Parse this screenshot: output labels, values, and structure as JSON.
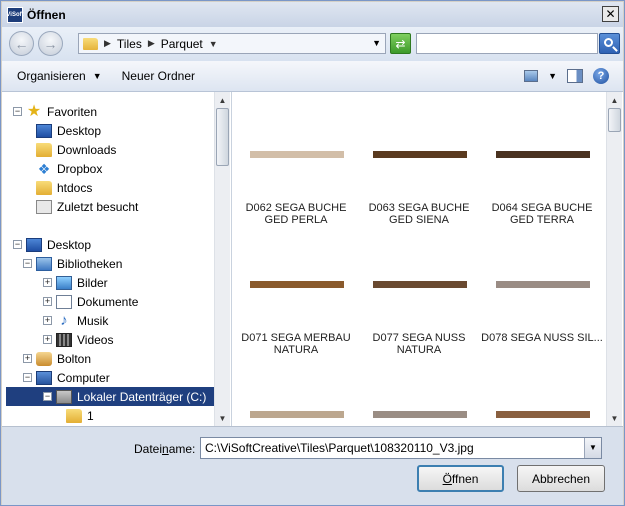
{
  "window": {
    "title": "Öffnen",
    "icon_text": "ViSoft"
  },
  "address": {
    "crumbs": [
      "Tiles",
      "Parquet"
    ],
    "search_placeholder": ""
  },
  "toolbar": {
    "organize_label": "Organisieren",
    "new_folder_label": "Neuer Ordner"
  },
  "nav_tree": [
    {
      "label": "Favoriten",
      "icon": "star-icon",
      "level": 0,
      "expander": "−"
    },
    {
      "label": "Desktop",
      "icon": "desktop-icon",
      "level": 1
    },
    {
      "label": "Downloads",
      "icon": "folder-icon",
      "level": 1
    },
    {
      "label": "Dropbox",
      "icon": "dropbox-icon",
      "level": 1
    },
    {
      "label": "htdocs",
      "icon": "folder-icon",
      "level": 1
    },
    {
      "label": "Zuletzt besucht",
      "icon": "recent-places-icon",
      "level": 1
    },
    {
      "label": "Desktop",
      "icon": "desktop-icon",
      "level": 0,
      "expander": "−"
    },
    {
      "label": "Bibliotheken",
      "icon": "libraries-icon",
      "level": 1,
      "expander": "−"
    },
    {
      "label": "Bilder",
      "icon": "pictures-icon",
      "level": 2,
      "expander": "+"
    },
    {
      "label": "Dokumente",
      "icon": "documents-icon",
      "level": 2,
      "expander": "+"
    },
    {
      "label": "Musik",
      "icon": "music-icon",
      "level": 2,
      "expander": "+"
    },
    {
      "label": "Videos",
      "icon": "videos-icon",
      "level": 2,
      "expander": "+"
    },
    {
      "label": "Bolton",
      "icon": "user-folder-icon",
      "level": 1,
      "expander": "+"
    },
    {
      "label": "Computer",
      "icon": "computer-icon",
      "level": 1,
      "expander": "−"
    },
    {
      "label": "Lokaler Datenträger (C:)",
      "icon": "drive-icon",
      "level": 2,
      "expander": "−",
      "selected": true
    },
    {
      "label": "1",
      "icon": "folder-icon",
      "level": 3
    }
  ],
  "files": [
    {
      "line1": "D062 SEGA BUCHE",
      "line2": "GED PERLA",
      "color": "#d2bea8"
    },
    {
      "line1": "D063 SEGA BUCHE",
      "line2": "GED SIENA",
      "color": "#5a3a1f"
    },
    {
      "line1": "D064 SEGA BUCHE",
      "line2": "GED TERRA",
      "color": "#4a3220"
    },
    {
      "line1": "D071 SEGA MERBAU",
      "line2": "NATURA",
      "color": "#8a5a2c"
    },
    {
      "line1": "D077 SEGA NUSS",
      "line2": "NATURA",
      "color": "#6a4a30"
    },
    {
      "line1": "D078  SEGA  NUSS SIL...",
      "line2": "",
      "color": "#9a8c84"
    },
    {
      "line1": "",
      "line2": "",
      "color": "#bca78f"
    },
    {
      "line1": "",
      "line2": "",
      "color": "#9a8d84"
    },
    {
      "line1": "",
      "line2": "",
      "color": "#8a6040"
    }
  ],
  "filename": {
    "label_pre": "Datei",
    "label_accel": "n",
    "label_post": "ame:",
    "value": "C:\\ViSoftCreative\\Tiles\\Parquet\\108320110_V3.jpg"
  },
  "buttons": {
    "open_pre": "Ö",
    "open_post": "ffnen",
    "cancel": "Abbrechen"
  }
}
